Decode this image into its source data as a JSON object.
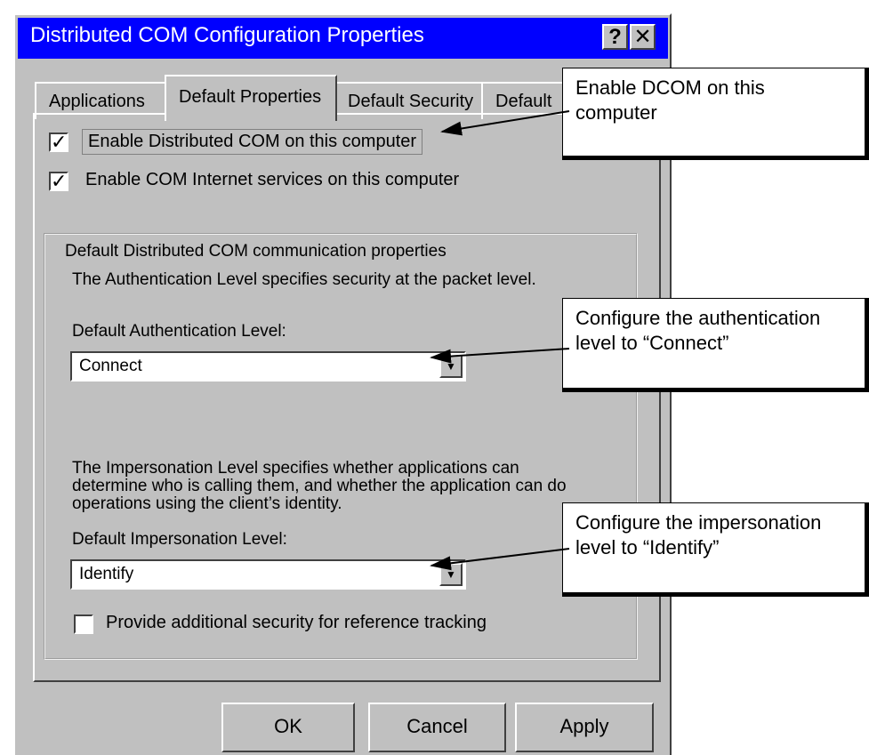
{
  "window": {
    "title": "Distributed COM Configuration Properties",
    "help_label": "?",
    "close_label": "✕"
  },
  "tabs": [
    "Applications",
    "Default Properties",
    "Default Security",
    "Default"
  ],
  "checks": {
    "enable_dcom": {
      "label": "Enable Distributed COM on this computer",
      "checked": true
    },
    "enable_internet": {
      "label": "Enable COM Internet services on this computer",
      "checked": true
    },
    "reference_tracking": {
      "label": "Provide additional security for reference tracking",
      "checked": false
    }
  },
  "group": {
    "legend": "Default Distributed COM communication properties",
    "auth_desc": "The Authentication Level specifies security at the packet level.",
    "auth_label": "Default Authentication Level:",
    "auth_value": "Connect",
    "imp_desc_1": "The Impersonation Level specifies whether applications can",
    "imp_desc_2": "determine who is calling them, and whether the application can do",
    "imp_desc_3": "operations using the client’s identity.",
    "imp_label": "Default Impersonation Level:",
    "imp_value": "Identify"
  },
  "buttons": {
    "ok": "OK",
    "cancel": "Cancel",
    "apply": "Apply"
  },
  "callouts": {
    "dcom_1": "Enable DCOM on this",
    "dcom_2": "computer",
    "auth_1": "Configure the authentication",
    "auth_2": "level to “Connect”",
    "imp_1": "Configure the impersonation",
    "imp_2": "level to “Identify”"
  },
  "colors": {
    "titlebar": "#0000ff",
    "face": "#c0c0c0"
  }
}
